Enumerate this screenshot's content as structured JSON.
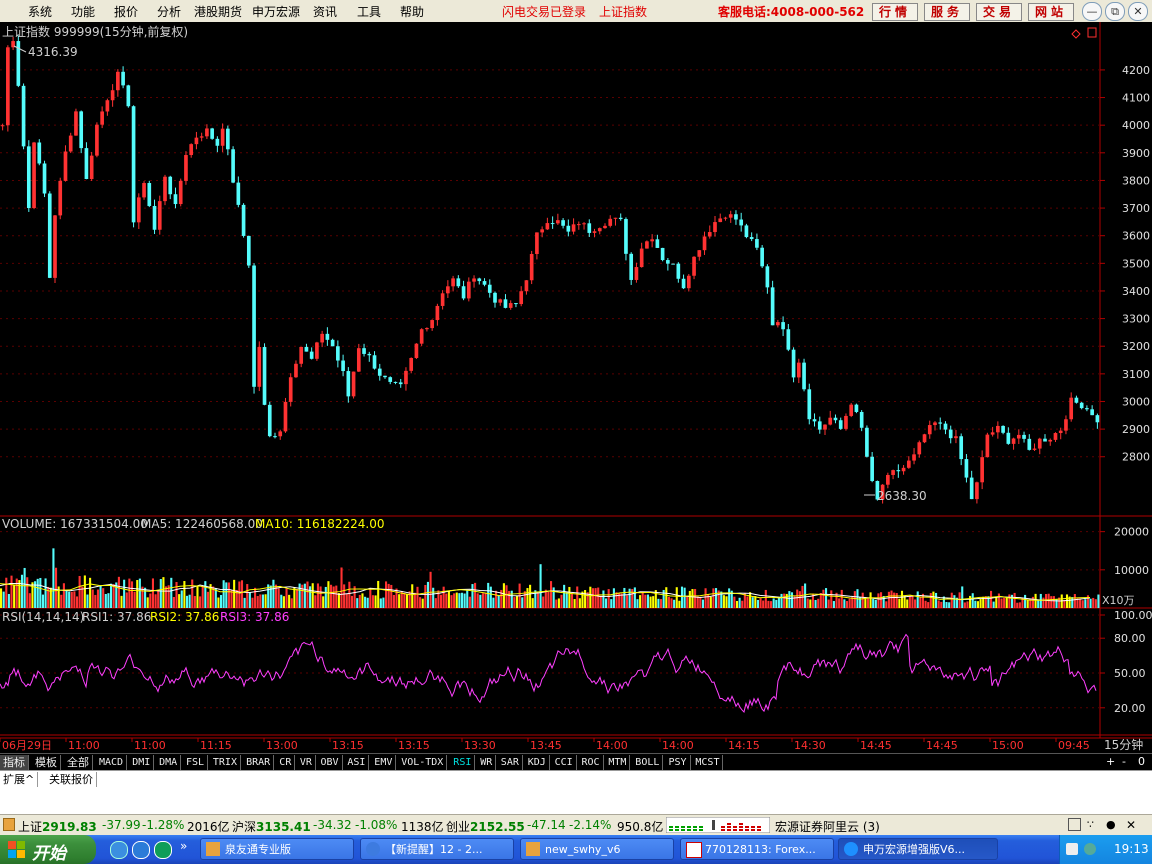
{
  "menu": {
    "items": [
      "系统",
      "功能",
      "报价",
      "分析",
      "港股期货",
      "申万宏源",
      "资讯",
      "工具",
      "帮助"
    ],
    "login_status": "闪电交易已登录",
    "current_index": "上证指数",
    "hotline_label": "客服电话:4008-000-562",
    "tabs": [
      "行情",
      "服务",
      "交易",
      "网站"
    ]
  },
  "chart": {
    "title": "上证指数 999999(15分钟,前复权)",
    "high_label": "4316.39",
    "low_label": "2638.30",
    "price_ticks": [
      "4200",
      "4100",
      "4000",
      "3900",
      "3800",
      "3700",
      "3600",
      "3500",
      "3400",
      "3300",
      "3200",
      "3100",
      "3000",
      "2900",
      "2800"
    ],
    "volume_label": "VOLUME: 167331504.00",
    "ma5_label": "MA5: 122460568.00",
    "ma10_label": "MA10: 116182224.00",
    "volume_ticks": [
      "20000",
      "10000"
    ],
    "volume_unit": "X10万",
    "rsi_label": "RSI(14,14,14)",
    "rsi1_label": "RSI1: 37.86",
    "rsi2_label": "RSI2: 37.86",
    "rsi3_label": "RSI3: 37.86",
    "rsi_ticks": [
      "100.00",
      "80.00",
      "50.00",
      "20.00"
    ],
    "time_labels": [
      "06月29日",
      "11:00",
      "11:00",
      "11:15",
      "13:00",
      "13:15",
      "13:15",
      "13:30",
      "13:45",
      "14:00",
      "14:00",
      "14:15",
      "14:30",
      "14:45",
      "14:45",
      "15:00",
      "09:45"
    ],
    "period": "15分钟",
    "colors": {
      "up": "#FF3232",
      "down": "#54FCFC",
      "ma5": "#FFFFFF",
      "ma10": "#FFFF00",
      "rsi": "#FF40FF",
      "axis": "#B00000"
    }
  },
  "chart_data": {
    "type": "candlestick",
    "title": "上证指数 999999(15分钟,前复权)",
    "ylim": [
      2600,
      4330
    ],
    "close_path": [
      [
        0,
        4000
      ],
      [
        1,
        4280
      ],
      [
        2,
        4316
      ],
      [
        3,
        4150
      ],
      [
        5,
        3700
      ],
      [
        6,
        3950
      ],
      [
        8,
        3750
      ],
      [
        9,
        3450
      ],
      [
        10,
        3680
      ],
      [
        12,
        3900
      ],
      [
        14,
        4050
      ],
      [
        16,
        3800
      ],
      [
        18,
        4000
      ],
      [
        20,
        4100
      ],
      [
        22,
        4180
      ],
      [
        24,
        4080
      ],
      [
        25,
        3650
      ],
      [
        27,
        3800
      ],
      [
        29,
        3620
      ],
      [
        31,
        3820
      ],
      [
        33,
        3700
      ],
      [
        35,
        3900
      ],
      [
        37,
        3960
      ],
      [
        39,
        3980
      ],
      [
        41,
        3930
      ],
      [
        42,
        4000
      ],
      [
        44,
        3800
      ],
      [
        46,
        3600
      ],
      [
        47,
        3500
      ],
      [
        48,
        3050
      ],
      [
        49,
        3200
      ],
      [
        50,
        2980
      ],
      [
        51,
        2870
      ],
      [
        53,
        2900
      ],
      [
        55,
        3100
      ],
      [
        57,
        3200
      ],
      [
        59,
        3150
      ],
      [
        61,
        3250
      ],
      [
        63,
        3200
      ],
      [
        65,
        3100
      ],
      [
        66,
        3020
      ],
      [
        68,
        3200
      ],
      [
        70,
        3160
      ],
      [
        72,
        3100
      ],
      [
        74,
        3060
      ],
      [
        76,
        3050
      ],
      [
        78,
        3150
      ],
      [
        80,
        3260
      ],
      [
        82,
        3300
      ],
      [
        84,
        3400
      ],
      [
        86,
        3440
      ],
      [
        88,
        3380
      ],
      [
        90,
        3460
      ],
      [
        92,
        3420
      ],
      [
        94,
        3370
      ],
      [
        96,
        3340
      ],
      [
        98,
        3350
      ],
      [
        100,
        3450
      ],
      [
        102,
        3600
      ],
      [
        104,
        3660
      ],
      [
        106,
        3650
      ],
      [
        108,
        3610
      ],
      [
        110,
        3650
      ],
      [
        112,
        3620
      ],
      [
        114,
        3640
      ],
      [
        116,
        3660
      ],
      [
        118,
        3650
      ],
      [
        120,
        3440
      ],
      [
        122,
        3560
      ],
      [
        124,
        3600
      ],
      [
        126,
        3520
      ],
      [
        128,
        3490
      ],
      [
        130,
        3420
      ],
      [
        132,
        3520
      ],
      [
        134,
        3600
      ],
      [
        136,
        3650
      ],
      [
        138,
        3680
      ],
      [
        140,
        3660
      ],
      [
        142,
        3600
      ],
      [
        144,
        3550
      ],
      [
        146,
        3420
      ],
      [
        147,
        3280
      ],
      [
        148,
        3300
      ],
      [
        150,
        3200
      ],
      [
        151,
        3100
      ],
      [
        152,
        3150
      ],
      [
        154,
        2950
      ],
      [
        156,
        2900
      ],
      [
        158,
        2940
      ],
      [
        160,
        2900
      ],
      [
        162,
        3000
      ],
      [
        164,
        2900
      ],
      [
        166,
        2700
      ],
      [
        167,
        2640
      ],
      [
        168,
        2700
      ],
      [
        170,
        2740
      ],
      [
        172,
        2760
      ],
      [
        174,
        2800
      ],
      [
        176,
        2880
      ],
      [
        178,
        2920
      ],
      [
        180,
        2900
      ],
      [
        182,
        2860
      ],
      [
        184,
        2720
      ],
      [
        185,
        2650
      ],
      [
        186,
        2700
      ],
      [
        188,
        2880
      ],
      [
        190,
        2900
      ],
      [
        192,
        2860
      ],
      [
        194,
        2880
      ],
      [
        196,
        2820
      ],
      [
        198,
        2860
      ],
      [
        200,
        2870
      ],
      [
        202,
        2900
      ],
      [
        204,
        3000
      ],
      [
        206,
        2990
      ],
      [
        208,
        2960
      ],
      [
        209,
        2920
      ]
    ],
    "volume_ylim": [
      0,
      22000
    ],
    "rsi_ylim": [
      0,
      100
    ]
  },
  "statusbar": {
    "sh_label": "上证",
    "sh_value": "2919.83",
    "sh_change": "-37.99",
    "sh_pct": "-1.28%",
    "sh_amount": "2016亿",
    "hs_label": "沪深",
    "hs_value": "3135.41",
    "hs_change": "-34.32",
    "hs_pct": "-1.08%",
    "hs_amount": "1138亿",
    "cy_label": "创业",
    "cy_value": "2152.55",
    "cy_change": "-47.14",
    "cy_pct": "-2.14%",
    "cy_amount": "950.8亿",
    "server": "宏源证券阿里云 (3)"
  },
  "bottom_tabs": {
    "indicator_tabs": [
      "指标",
      "模板",
      "全部",
      "MACD",
      "DMI",
      "DMA",
      "FSL",
      "TRIX",
      "BRAR",
      "CR",
      "VR",
      "OBV",
      "ASI",
      "EMV",
      "VOL-TDX",
      "RSI",
      "WR",
      "SAR",
      "KDJ",
      "CCI",
      "ROC",
      "MTM",
      "BOLL",
      "PSY",
      "MCST"
    ],
    "active_tab": "RSI",
    "sub_tabs": [
      "扩展^",
      "关联报价"
    ]
  },
  "taskbar": {
    "start_label": "开始",
    "tasks": [
      "泉友通专业版",
      "【新提醒】12 - 2...",
      "new_swhy_v6",
      "770128113: Forex...",
      "申万宏源增强版V6..."
    ],
    "clock": "19:13"
  }
}
